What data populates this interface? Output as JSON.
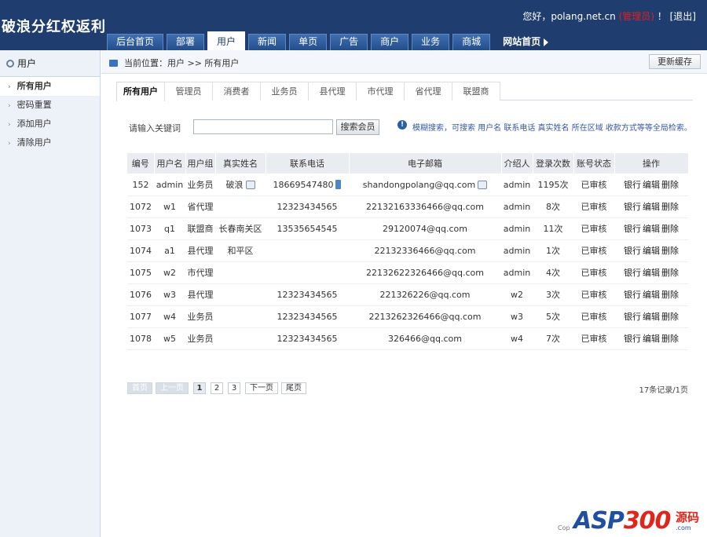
{
  "app": {
    "title": "破浪分红权返利",
    "greeting": "您好，polang.net.cn",
    "admin_link": "(管理员)",
    "exclaim": "！",
    "logout": "[退出]"
  },
  "nav": {
    "items": [
      "后台首页",
      "部署",
      "用户",
      "新闻",
      "单页",
      "广告",
      "商户",
      "业务",
      "商城"
    ],
    "active_index": 2,
    "site_home": "网站首页"
  },
  "sidebar": {
    "title": "用户",
    "items": [
      "所有用户",
      "密码重置",
      "添加用户",
      "清除用户"
    ],
    "active_index": 0
  },
  "breadcrumb": {
    "text": "当前位置：用户 >> 所有用户",
    "refresh_label": "更新缓存"
  },
  "tabs": {
    "items": [
      "所有用户",
      "管理员",
      "消费者",
      "业务员",
      "县代理",
      "市代理",
      "省代理",
      "联盟商"
    ],
    "active_index": 0
  },
  "search": {
    "label": "请输入关键词",
    "value": "",
    "button": "搜索会员",
    "hint": "模糊搜索，可搜索 用户名 联系电话 真实姓名 所在区域 收款方式等等全局检索。"
  },
  "table": {
    "columns": [
      "编号",
      "用户名",
      "用户组",
      "真实姓名",
      "联系电话",
      "电子邮箱",
      "介绍人",
      "登录次数",
      "账号状态",
      "操作"
    ],
    "actions": [
      "银行",
      "编辑",
      "删除"
    ],
    "rows": [
      {
        "id": "152",
        "user": "admin",
        "group": "业务员",
        "name": "破浪",
        "phone": "18669547480",
        "email": "shandongpolang@qq.com",
        "ref": "admin",
        "logins": "1195次",
        "status": "已审核",
        "icons": true
      },
      {
        "id": "1072",
        "user": "w1",
        "group": "省代理",
        "name": "",
        "phone": "12323434565",
        "email": "22132163336466@qq.com",
        "ref": "admin",
        "logins": "8次",
        "status": "已审核"
      },
      {
        "id": "1073",
        "user": "q1",
        "group": "联盟商",
        "name": "长春南关区",
        "phone": "13535654545",
        "email": "29120074@qq.com",
        "ref": "admin",
        "logins": "11次",
        "status": "已审核"
      },
      {
        "id": "1074",
        "user": "a1",
        "group": "县代理",
        "name": "和平区",
        "phone": "",
        "email": "22132336466@qq.com",
        "ref": "admin",
        "logins": "1次",
        "status": "已审核"
      },
      {
        "id": "1075",
        "user": "w2",
        "group": "市代理",
        "name": "",
        "phone": "",
        "email": "22132622326466@qq.com",
        "ref": "admin",
        "logins": "4次",
        "status": "已审核"
      },
      {
        "id": "1076",
        "user": "w3",
        "group": "县代理",
        "name": "",
        "phone": "12323434565",
        "email": "221326226@qq.com",
        "ref": "w2",
        "logins": "3次",
        "status": "已审核"
      },
      {
        "id": "1077",
        "user": "w4",
        "group": "业务员",
        "name": "",
        "phone": "12323434565",
        "email": "2213262326466@qq.com",
        "ref": "w3",
        "logins": "5次",
        "status": "已审核"
      },
      {
        "id": "1078",
        "user": "w5",
        "group": "业务员",
        "name": "",
        "phone": "12323434565",
        "email": "326466@qq.com",
        "ref": "w4",
        "logins": "7次",
        "status": "已审核"
      }
    ]
  },
  "pager": {
    "first": "首页",
    "prev": "上一页",
    "pages": [
      "1",
      "2",
      "3"
    ],
    "current": "1",
    "next": "下一页",
    "last": "尾页",
    "info": "17条记录/1页"
  },
  "watermark": {
    "asp": "ASP",
    "num": "300",
    "cn": "源码",
    "url": ".com",
    "copyright": "Cop"
  },
  "colors": {
    "header_bg": "#1f3d6e",
    "accent": "#2b5ea8",
    "admin_red": "#e02020"
  }
}
